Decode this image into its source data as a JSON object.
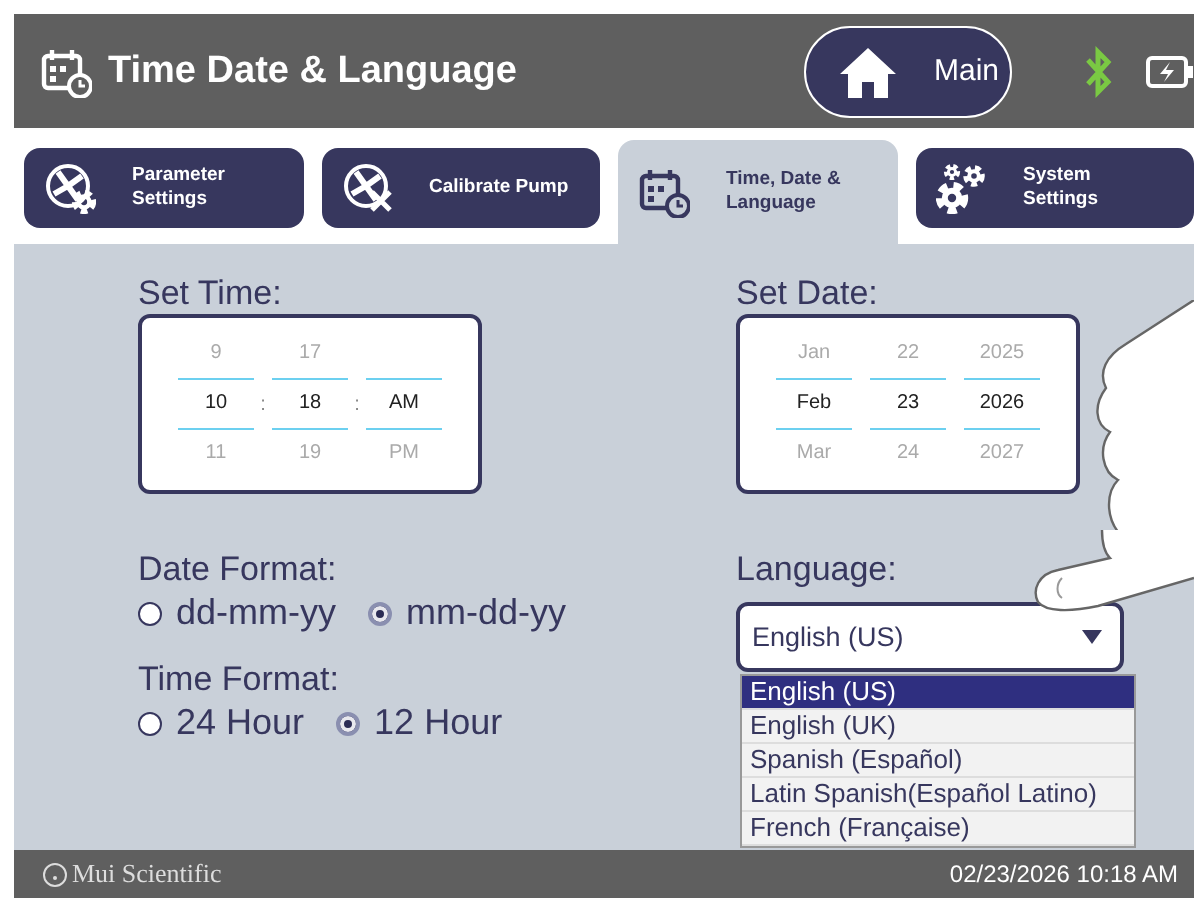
{
  "header": {
    "title": "Time Date & Language",
    "main_button": "Main"
  },
  "tabs": [
    {
      "label": "Parameter Settings",
      "kind": "fan-gear",
      "selected": false
    },
    {
      "label": "Calibrate Pump",
      "kind": "fan-tool",
      "selected": false
    },
    {
      "label": "Time, Date & Language",
      "kind": "calendar",
      "selected": true
    },
    {
      "label": "System Settings",
      "kind": "gears",
      "selected": false
    }
  ],
  "set_time": {
    "label": "Set Time:",
    "separator": ":",
    "columns": [
      {
        "above": "9",
        "value": "10",
        "below": "11"
      },
      {
        "above": "17",
        "value": "18",
        "below": "19"
      },
      {
        "value": "AM",
        "below": "PM"
      }
    ]
  },
  "set_date": {
    "label": "Set Date:",
    "columns": [
      {
        "above": "Jan",
        "value": "Feb",
        "below": "Mar"
      },
      {
        "above": "22",
        "value": "23",
        "below": "24"
      },
      {
        "above": "2025",
        "value": "2026",
        "below": "2027"
      }
    ]
  },
  "date_format": {
    "label": "Date Format:",
    "options": [
      {
        "label": "dd-mm-yy",
        "selected": false
      },
      {
        "label": "mm-dd-yy",
        "selected": true
      }
    ]
  },
  "time_format": {
    "label": "Time Format:",
    "options": [
      {
        "label": "24 Hour",
        "selected": false
      },
      {
        "label": "12 Hour",
        "selected": true
      }
    ]
  },
  "language": {
    "label": "Language:",
    "value": "English (US)",
    "options": [
      {
        "label": "English (US)",
        "selected": true
      },
      {
        "label": "English (UK)",
        "selected": false
      },
      {
        "label": "Spanish (Español)",
        "selected": false
      },
      {
        "label": "Latin Spanish(Español Latino)",
        "selected": false
      },
      {
        "label": "French (Française)",
        "selected": false
      }
    ]
  },
  "footer": {
    "brand": "Mui Scientific",
    "datetime": "02/23/2026 10:18 AM"
  }
}
